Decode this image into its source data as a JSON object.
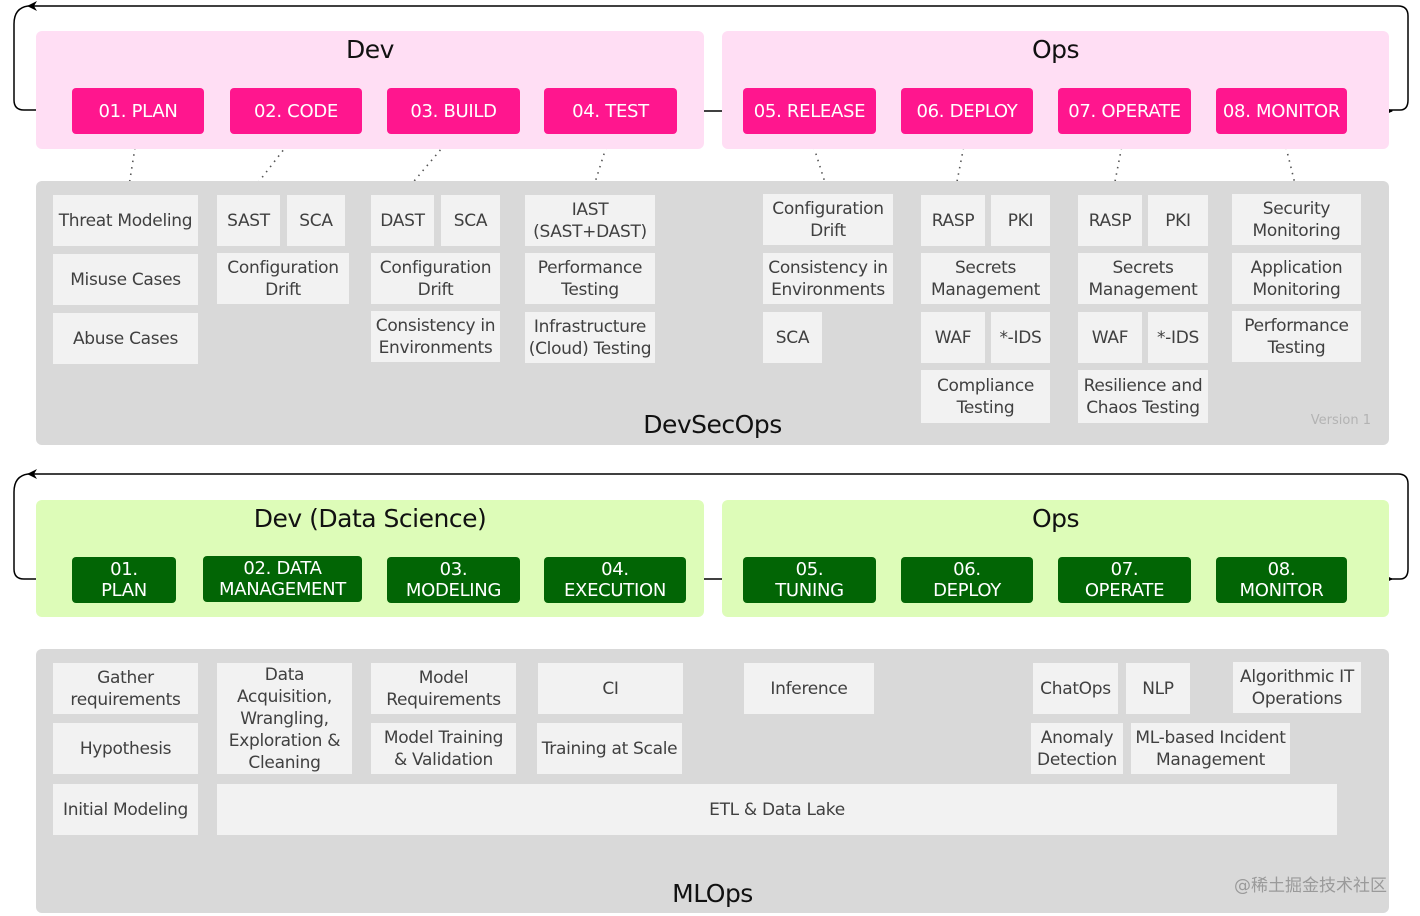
{
  "devsecops": {
    "dev_title": "Dev",
    "ops_title": "Ops",
    "panel_title": "DevSecOps",
    "version": "Version 1",
    "accent": "#ff168e",
    "group_bg": "#ffdef4",
    "stages": [
      "01. PLAN",
      "02. CODE",
      "03. BUILD",
      "04. TEST",
      "05. RELEASE",
      "06. DEPLOY",
      "07. OPERATE",
      "08. MONITOR"
    ],
    "cards": {
      "plan": [
        "Threat Modeling",
        "Misuse Cases",
        "Abuse Cases"
      ],
      "code": [
        "SAST",
        "SCA",
        "Configuration\nDrift"
      ],
      "build": [
        "DAST",
        "SCA",
        "Configuration\nDrift",
        "Consistency in\nEnvironments"
      ],
      "test": [
        "IAST\n(SAST+DAST)",
        "Performance\nTesting",
        "Infrastructure\n(Cloud) Testing"
      ],
      "release": [
        "Configuration\nDrift",
        "Consistency in\nEnvironments",
        "SCA"
      ],
      "deploy": [
        "RASP",
        "PKI",
        "Secrets\nManagement",
        "WAF",
        "*-IDS",
        "Compliance\nTesting"
      ],
      "operate": [
        "RASP",
        "PKI",
        "Secrets\nManagement",
        "WAF",
        "*-IDS",
        "Resilience and\nChaos Testing"
      ],
      "monitor": [
        "Security\nMonitoring",
        "Application\nMonitoring",
        "Performance\nTesting"
      ]
    }
  },
  "mlops": {
    "dev_title": "Dev (Data Science)",
    "ops_title": "Ops",
    "panel_title": "MLOps",
    "accent": "#026505",
    "group_bg": "#ddfcb8",
    "stages": [
      "01.\nPLAN",
      "02. DATA\nMANAGEMENT",
      "03.\nMODELING",
      "04.\nEXECUTION",
      "05.\nTUNING",
      "06.\nDEPLOY",
      "07.\nOPERATE",
      "08.\nMONITOR"
    ],
    "cards": {
      "plan": [
        "Gather\nrequirements",
        "Hypothesis",
        "Initial Modeling"
      ],
      "data": [
        "Data\nAcquisition,\nWrangling,\nExploration &\nCleaning"
      ],
      "modeling": [
        "Model\nRequirements",
        "Model Training\n& Validation"
      ],
      "execution": [
        "CI",
        "Training at Scale"
      ],
      "tuning": [
        "Inference"
      ],
      "operate": [
        "ChatOps",
        "NLP",
        "Anomaly\nDetection",
        "ML-based Incident\nManagement"
      ],
      "monitor": [
        "Algorithmic IT\nOperations"
      ],
      "etl": "ETL & Data Lake"
    }
  },
  "watermark": "@稀土掘金技术社区"
}
